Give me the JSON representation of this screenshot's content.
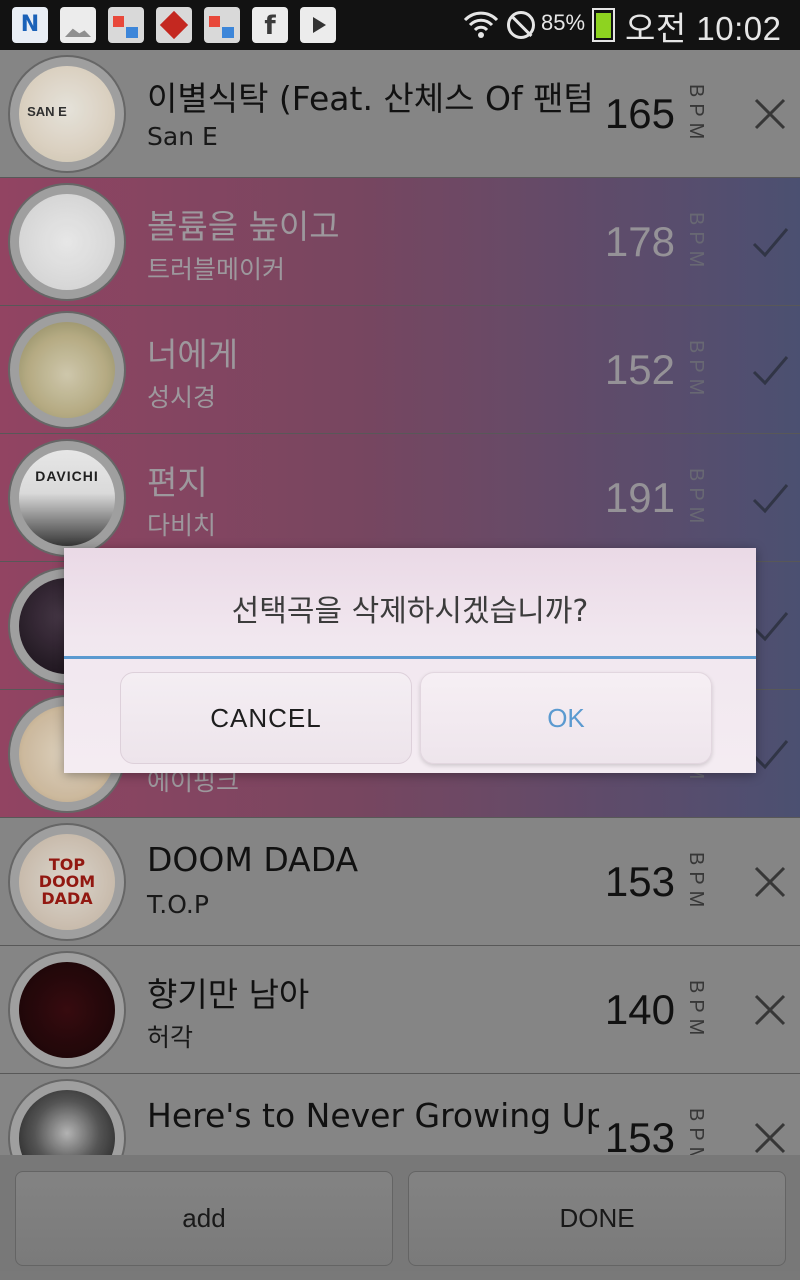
{
  "status_bar": {
    "battery_text": "85%",
    "battery_level": 0.85,
    "time": "오전 10:02",
    "icons": [
      "naver-icon",
      "gallery-icon",
      "store-icon",
      "red-app-icon",
      "store-icon",
      "facebook-icon",
      "play-store-icon",
      "wifi-icon",
      "no-entry-icon",
      "battery-icon"
    ]
  },
  "songs": [
    {
      "title": "이별식탁 (Feat. 산체스 Of 팬텀",
      "artist": "San E",
      "bpm": "165",
      "bpm_label": "BPM",
      "selected": false,
      "action_icon": "close-icon",
      "art_text": "SAN E"
    },
    {
      "title": "볼륨을 높이고",
      "artist": "트러블메이커",
      "bpm": "178",
      "bpm_label": "BPM",
      "selected": true,
      "action_icon": "check-icon",
      "art_text": ""
    },
    {
      "title": "너에게",
      "artist": "성시경",
      "bpm": "152",
      "bpm_label": "BPM",
      "selected": true,
      "action_icon": "check-icon",
      "art_text": ""
    },
    {
      "title": "편지",
      "artist": "다비치",
      "bpm": "191",
      "bpm_label": "BPM",
      "selected": true,
      "action_icon": "check-icon",
      "art_text": "DAVICHI"
    },
    {
      "title": "",
      "artist": "",
      "bpm": "",
      "bpm_label": "",
      "selected": true,
      "action_icon": "check-icon",
      "art_text": ""
    },
    {
      "title": "",
      "artist": "에이핑크",
      "bpm": "",
      "bpm_label": "BPM",
      "selected": true,
      "action_icon": "check-icon",
      "art_text": ""
    },
    {
      "title": "DOOM DADA",
      "artist": "T.O.P",
      "bpm": "153",
      "bpm_label": "BPM",
      "selected": false,
      "action_icon": "close-icon",
      "art_text": "TOP DOOM DADA"
    },
    {
      "title": "향기만 남아",
      "artist": "허각",
      "bpm": "140",
      "bpm_label": "BPM",
      "selected": false,
      "action_icon": "close-icon",
      "art_text": ""
    },
    {
      "title": "Here's to Never Growing Up",
      "artist": "",
      "bpm": "153",
      "bpm_label": "BPM",
      "selected": false,
      "action_icon": "close-icon",
      "art_text": ""
    }
  ],
  "bottom_bar": {
    "add_label": "add",
    "done_label": "DONE"
  },
  "dialog": {
    "message": "선택곡을 삭제하시겠습니까?",
    "cancel_label": "CANCEL",
    "ok_label": "OK"
  },
  "colors": {
    "accent": "#5b9ad0",
    "selected_row_start": "#9a4868",
    "selected_row_end": "#505578",
    "battery": "#8ed320"
  }
}
